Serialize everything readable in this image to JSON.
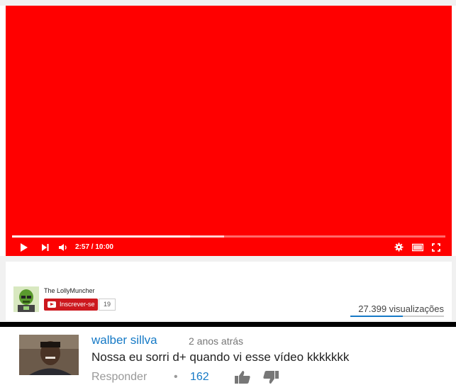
{
  "player": {
    "time_current": "2:57",
    "time_separator": "/",
    "time_total": "10:00",
    "progress_fraction": 0.41,
    "buffer_fraction": 0.49,
    "colors": {
      "background": "#ff0000"
    }
  },
  "channel": {
    "name": "The LollyMuncher",
    "subscribe_label": "Inscrever-se",
    "subscriber_count": "19"
  },
  "video": {
    "views": "27.399 visualizações"
  },
  "comment": {
    "author": "walber sillva",
    "time": "2 anos atrás",
    "text": "Nossa eu sorri d+ quando vi esse vídeo kkkkkkk",
    "reply_label": "Responder",
    "separator": "•",
    "likes": "162"
  },
  "icons": {
    "play": "play-icon",
    "next": "next-icon",
    "volume": "volume-icon",
    "settings": "gear-icon",
    "theater": "theater-mode-icon",
    "fullscreen": "fullscreen-icon",
    "like": "thumbs-up-icon",
    "dislike": "thumbs-down-icon"
  },
  "colors": {
    "accent_blue": "#167ac6",
    "subscribe_red": "#cc181e"
  }
}
